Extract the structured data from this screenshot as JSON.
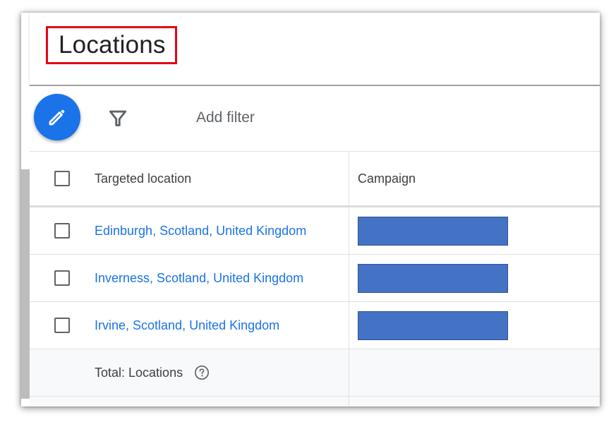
{
  "header": {
    "title": "Locations"
  },
  "toolbar": {
    "edit_icon": "pencil-icon",
    "filter_icon": "filter-funnel-icon",
    "add_filter_label": "Add filter"
  },
  "table": {
    "columns": [
      "Targeted location",
      "Campaign"
    ],
    "rows": [
      {
        "location": "Edinburgh, Scotland, United Kingdom",
        "campaign": ""
      },
      {
        "location": "Inverness, Scotland, United Kingdom",
        "campaign": ""
      },
      {
        "location": "Irvine, Scotland, United Kingdom",
        "campaign": ""
      }
    ],
    "total_label": "Total: Locations",
    "total_help_icon": "help-circle-icon"
  },
  "colors": {
    "accent": "#1a73e8",
    "highlight_border": "#e30613",
    "redaction_fill": "#4472c4"
  }
}
